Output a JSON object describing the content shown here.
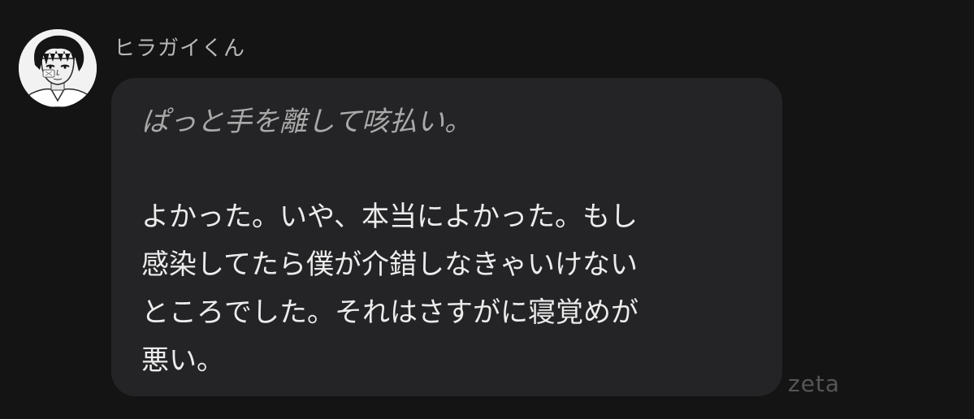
{
  "sender": {
    "name": "ヒラガイくん",
    "avatar_icon": "character-portrait-icon"
  },
  "message": {
    "action": "ぱっと手を離して咳払い。",
    "speech_lines": [
      "よかった。いや、本当によかった。もし",
      "感染してたら僕が介錯しなきゃいけない",
      "ところでした。それはさすがに寝覚めが",
      "悪い。"
    ]
  },
  "watermark": "zeta",
  "colors": {
    "background": "#141414",
    "bubble": "#242426",
    "action_text": "#a9a9a9",
    "speech_text": "#ececec",
    "name_text": "#b8b8b8"
  }
}
